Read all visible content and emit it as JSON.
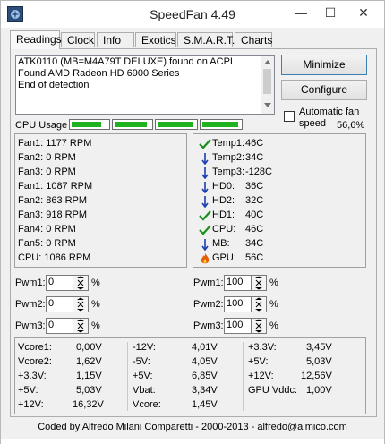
{
  "window": {
    "title": "SpeedFan 4.49"
  },
  "title_buttons": {
    "minimize": "—",
    "maximize": "☐",
    "close": "✕"
  },
  "tabs": [
    {
      "label": "Readings"
    },
    {
      "label": "Clock"
    },
    {
      "label": "Info"
    },
    {
      "label": "Exotics"
    },
    {
      "label": "S.M.A.R.T."
    },
    {
      "label": "Charts"
    }
  ],
  "log": {
    "lines": [
      "ATK0110 (MB=M4A79T DELUXE) found on ACPI",
      "Found AMD Radeon HD 6900 Series",
      "End of detection"
    ]
  },
  "buttons": {
    "minimize": "Minimize",
    "configure": "Configure"
  },
  "auto_fan": {
    "label": "Automatic fan speed",
    "checked": false
  },
  "cpu_usage": {
    "label": "CPU Usage",
    "cores": [
      0.82,
      0.9,
      0.92,
      0.95
    ],
    "percent": "56,6%"
  },
  "fans": [
    {
      "name": "Fan1:",
      "value": "1177 RPM"
    },
    {
      "name": "Fan2:",
      "value": "0 RPM"
    },
    {
      "name": "Fan3:",
      "value": "0 RPM"
    },
    {
      "name": "Fan1:",
      "value": "1087 RPM"
    },
    {
      "name": "Fan2:",
      "value": "863 RPM"
    },
    {
      "name": "Fan3:",
      "value": "918 RPM"
    },
    {
      "name": "Fan4:",
      "value": "0 RPM"
    },
    {
      "name": "Fan5:",
      "value": "0 RPM"
    },
    {
      "name": "CPU:",
      "value": "1086 RPM"
    }
  ],
  "temps": [
    {
      "name": "Temp1:",
      "value": "46C",
      "icon": "check-icon"
    },
    {
      "name": "Temp2:",
      "value": "34C",
      "icon": "arrow-down-icon"
    },
    {
      "name": "Temp3:",
      "value": "-128C",
      "icon": "arrow-down-icon"
    },
    {
      "name": "HD0:",
      "value": "36C",
      "icon": "arrow-down-icon"
    },
    {
      "name": "HD2:",
      "value": "32C",
      "icon": "arrow-down-icon"
    },
    {
      "name": "HD1:",
      "value": "40C",
      "icon": "check-icon"
    },
    {
      "name": "CPU:",
      "value": "46C",
      "icon": "check-icon"
    },
    {
      "name": "MB:",
      "value": "34C",
      "icon": "arrow-down-icon"
    },
    {
      "name": "GPU:",
      "value": "56C",
      "icon": "flame-icon"
    }
  ],
  "pwm_left": [
    {
      "label": "Pwm1:",
      "value": "0",
      "unit": "%"
    },
    {
      "label": "Pwm2:",
      "value": "0",
      "unit": "%"
    },
    {
      "label": "Pwm3:",
      "value": "0",
      "unit": "%"
    }
  ],
  "pwm_right": [
    {
      "label": "Pwm1:",
      "value": "100",
      "unit": "%"
    },
    {
      "label": "Pwm2:",
      "value": "100",
      "unit": "%"
    },
    {
      "label": "Pwm3:",
      "value": "100",
      "unit": "%"
    }
  ],
  "voltages": {
    "col1": [
      {
        "name": "Vcore1:",
        "value": "0,00V"
      },
      {
        "name": "Vcore2:",
        "value": "1,62V"
      },
      {
        "name": "+3.3V:",
        "value": "1,15V"
      },
      {
        "name": "+5V:",
        "value": "5,03V"
      },
      {
        "name": "+12V:",
        "value": "16,32V"
      }
    ],
    "col2": [
      {
        "name": "-12V:",
        "value": "4,01V"
      },
      {
        "name": "-5V:",
        "value": "4,05V"
      },
      {
        "name": "+5V:",
        "value": "6,85V"
      },
      {
        "name": "Vbat:",
        "value": "3,34V"
      },
      {
        "name": "Vcore:",
        "value": "1,45V"
      }
    ],
    "col3": [
      {
        "name": "+3.3V:",
        "value": "3,45V"
      },
      {
        "name": "+5V:",
        "value": "5,03V"
      },
      {
        "name": "+12V:",
        "value": "12,56V"
      },
      {
        "name": "GPU Vddc:",
        "value": "1,00V"
      }
    ]
  },
  "footer": "Coded by Alfredo Milani Comparetti - 2000-2013 - alfredo@almico.com",
  "colors": {
    "accent": "#3c7fb1",
    "bar": "#1fb41f",
    "check": "#1a8f1a",
    "arrow": "#1a3fb0",
    "flame": "#e65c00"
  }
}
